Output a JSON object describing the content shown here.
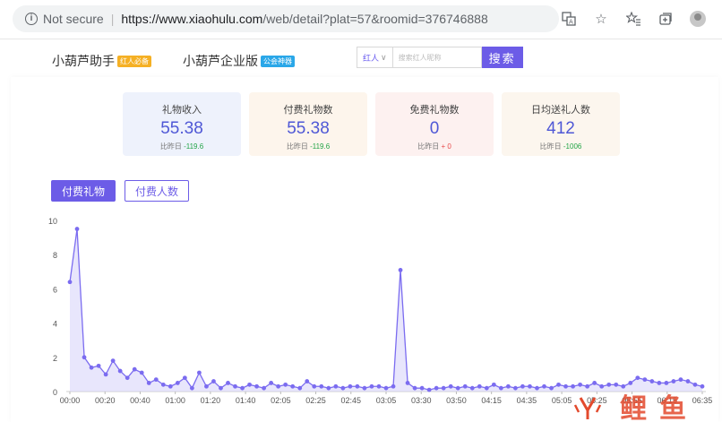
{
  "browser": {
    "security_label": "Not secure",
    "url_host": "https://www.xiaohulu.com",
    "url_path": "/web/detail?plat=57&roomid=376746888",
    "icons": [
      "translate-icon",
      "star-icon",
      "favorites-icon",
      "collections-icon",
      "profile-icon"
    ]
  },
  "nav": {
    "brand1": "小葫芦助手",
    "brand1_tag": "红人必备",
    "brand2": "小葫芦企业版",
    "brand2_tag": "公会神器",
    "search_select": "红人",
    "search_placeholder": "搜索红人昵称",
    "search_button": "搜索"
  },
  "stats": [
    {
      "title": "礼物收入",
      "value": "55.38",
      "compare_label": "比昨日",
      "compare_value": "-119.6",
      "dir": "down",
      "bg": "#eef2fc"
    },
    {
      "title": "付费礼物数",
      "value": "55.38",
      "compare_label": "比昨日",
      "compare_value": "-119.6",
      "dir": "down",
      "bg": "#fdf5ec"
    },
    {
      "title": "免费礼物数",
      "value": "0",
      "compare_label": "比昨日",
      "compare_value": "+ 0",
      "dir": "up",
      "bg": "#fdf1f0"
    },
    {
      "title": "日均送礼人数",
      "value": "412",
      "compare_label": "比昨日",
      "compare_value": "-1006",
      "dir": "down",
      "bg": "#fcf6ee"
    }
  ],
  "tabs": {
    "paid_gifts": "付费礼物",
    "paid_people": "付费人数"
  },
  "colors": {
    "accent": "#6c5ce7",
    "line": "#7b6cf0",
    "area": "#d6d1fa"
  },
  "watermark": "火鲤鱼",
  "chart_data": {
    "type": "line",
    "x_tick_labels": [
      "00:00",
      "00:20",
      "00:40",
      "01:00",
      "01:20",
      "01:40",
      "02:05",
      "02:25",
      "02:45",
      "03:05",
      "03:30",
      "03:50",
      "04:15",
      "04:35",
      "05:05",
      "05:25",
      "05:55",
      "06:15",
      "06:35"
    ],
    "yticks": [
      0,
      2,
      4,
      6,
      8,
      10
    ],
    "ylim": [
      0,
      10
    ],
    "values": [
      6.4,
      9.5,
      2.0,
      1.4,
      1.5,
      1.0,
      1.8,
      1.2,
      0.8,
      1.3,
      1.1,
      0.5,
      0.7,
      0.4,
      0.3,
      0.5,
      0.8,
      0.2,
      1.1,
      0.3,
      0.6,
      0.2,
      0.5,
      0.3,
      0.2,
      0.4,
      0.3,
      0.2,
      0.5,
      0.3,
      0.4,
      0.3,
      0.2,
      0.6,
      0.3,
      0.3,
      0.2,
      0.3,
      0.2,
      0.3,
      0.3,
      0.2,
      0.3,
      0.3,
      0.2,
      0.3,
      7.1,
      0.5,
      0.2,
      0.2,
      0.1,
      0.2,
      0.2,
      0.3,
      0.2,
      0.3,
      0.2,
      0.3,
      0.2,
      0.4,
      0.2,
      0.3,
      0.2,
      0.3,
      0.3,
      0.2,
      0.3,
      0.2,
      0.4,
      0.3,
      0.3,
      0.4,
      0.3,
      0.5,
      0.3,
      0.4,
      0.4,
      0.3,
      0.5,
      0.8,
      0.7,
      0.6,
      0.5,
      0.5,
      0.6,
      0.7,
      0.6,
      0.4,
      0.3
    ]
  }
}
